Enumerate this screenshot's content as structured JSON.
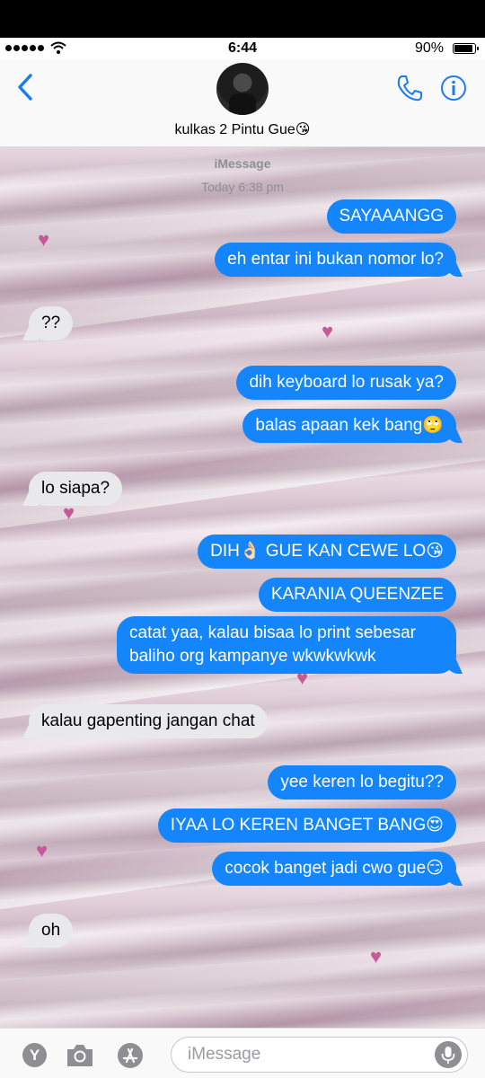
{
  "status": {
    "time": "6:44",
    "battery": "90%",
    "battery_fraction": 0.9
  },
  "header": {
    "contact_name": "kulkas 2 Pintu Gue😘"
  },
  "thread": {
    "service": "iMessage",
    "timestamp": "Today 6:38 pm",
    "messages": [
      {
        "side": "out",
        "text": "SAYAAANGG"
      },
      {
        "side": "out",
        "text": "eh entar ini bukan nomor lo?"
      },
      {
        "side": "in",
        "text": "??"
      },
      {
        "side": "out",
        "text": "dih keyboard lo rusak ya?"
      },
      {
        "side": "out",
        "text": "balas apaan kek bang🙄"
      },
      {
        "side": "in",
        "text": "lo siapa?"
      },
      {
        "side": "out",
        "text": "DIH👌🏻 GUE KAN CEWE LO😘"
      },
      {
        "side": "out",
        "text": "KARANIA QUEENZEE"
      },
      {
        "side": "out",
        "text": "catat yaa, kalau bisaa lo print sebesar baliho org kampanye wkwkwkwk"
      },
      {
        "side": "in",
        "text": "kalau gapenting jangan chat"
      },
      {
        "side": "out",
        "text": "yee keren lo begitu??"
      },
      {
        "side": "out",
        "text": "IYAA LO KEREN BANGET BANG😍"
      },
      {
        "side": "out",
        "text": "cocok banget jadi cwo gue😏"
      },
      {
        "side": "in",
        "text": "oh"
      }
    ]
  },
  "compose": {
    "apps_button_label": "Y",
    "placeholder": "iMessage"
  },
  "colors": {
    "outgoing_bubble": "#1585fb",
    "incoming_bubble": "#e9e9eb",
    "accent": "#1a7cf5"
  },
  "icons": {
    "back": "chevron-left-icon",
    "call": "phone-icon",
    "details": "info-icon",
    "camera": "camera-icon",
    "app_store": "app-store-icon",
    "mic": "microphone-icon"
  }
}
